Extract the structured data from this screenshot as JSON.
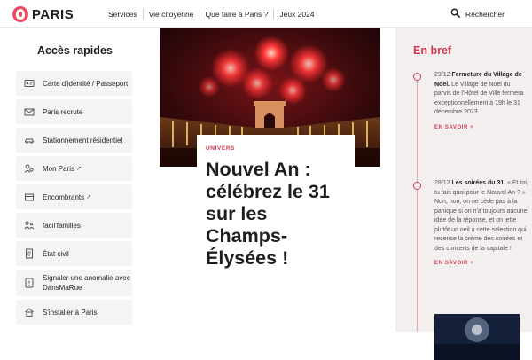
{
  "header": {
    "logo_text": "PARIS",
    "nav": [
      "Services",
      "Vie citoyenne",
      "Que faire à Paris ?",
      "Jeux 2024"
    ],
    "search_label": "Rechercher"
  },
  "sidebar": {
    "title": "Accès rapides",
    "items": [
      {
        "label": "Carte d'identité / Passeport",
        "icon": "id-card-icon"
      },
      {
        "label": "Paris recrute",
        "icon": "mail-icon"
      },
      {
        "label": "Stationnement résidentiel",
        "icon": "car-icon"
      },
      {
        "label": "Mon Paris",
        "icon": "user-icon",
        "external": "↗"
      },
      {
        "label": "Encombrants",
        "icon": "box-icon",
        "external": "↗"
      },
      {
        "label": "facil'familles",
        "icon": "family-icon"
      },
      {
        "label": "État civil",
        "icon": "document-icon"
      },
      {
        "label": "Signaler une anomalie avec DansMaRue",
        "icon": "report-icon"
      },
      {
        "label": "S'installer à Paris",
        "icon": "home-icon"
      }
    ]
  },
  "featured": {
    "category": "UNIVERS",
    "title": "Nouvel An : célébrez le 31 sur les Champs-Élysées !"
  },
  "en_bref": {
    "title": "En bref",
    "items": [
      {
        "date": "29/12",
        "headline": "Fermeture du Village de Noël.",
        "body": "Le Village de Noël du parvis de l'Hôtel de Ville fermera exceptionnellement à 19h le 31 décembre 2023.",
        "more": "EN SAVOIR +"
      },
      {
        "date": "28/12",
        "headline": "Les soirées du 31.",
        "body": "« Et toi, tu fais quoi pour le Nouvel An ? » Non, non, on ne cède pas à la panique si on n'a toujours aucune idée de la réponse, et on jette plutôt un oeil à cette sélection qui recense la crème des soirées et des concerts de la capitale !",
        "more": "EN SAVOIR +"
      }
    ]
  },
  "colors": {
    "accent": "#d33a52",
    "panel": "#f3efee",
    "tile": "#f4f4f4"
  }
}
